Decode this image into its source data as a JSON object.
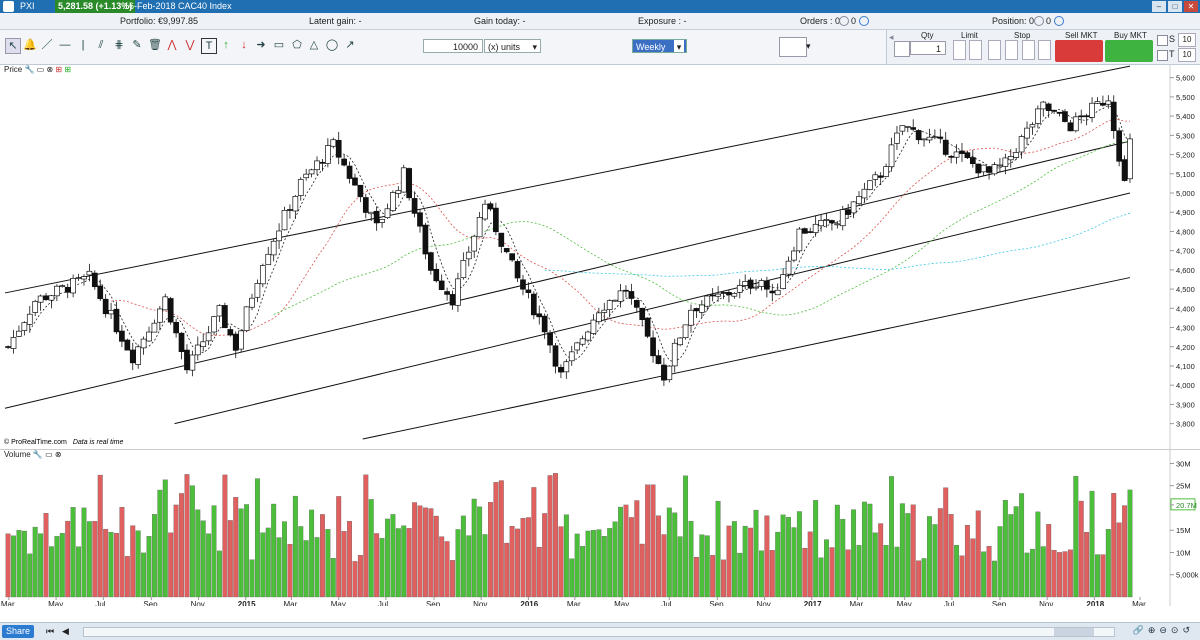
{
  "window": {
    "app": "PXI",
    "price_badge": "5,281.58 (+1.13%)",
    "instrument": "16-Feb-2018 CAC40 Index"
  },
  "infobar": {
    "portfolio_label": "Portfolio: €9,997.85",
    "latent_gain_label": "Latent gain: -",
    "gain_today_label": "Gain today: -",
    "exposure_label": "Exposure : -",
    "orders_label": "Orders : 0",
    "orders_b": "0",
    "position_label": "Position: 0",
    "position_b": "0"
  },
  "toolbar": {
    "quantity": "10000",
    "units": "(x) units",
    "period": "Weekly"
  },
  "order_panel": {
    "qty_label": "Qty",
    "qty_value": "1",
    "limit_label": "Limit",
    "stop_label": "Stop",
    "sell_label": "Sell MKT",
    "buy_label": "Buy MKT",
    "s_label": "S",
    "t_label": "T",
    "s_value": "10",
    "t_value": "10"
  },
  "price_panel": {
    "title": "Price",
    "attribution_a": "© ProRealTime.com",
    "attribution_b": "Data is real time"
  },
  "volume_panel": {
    "title": "Volume"
  },
  "footer": {
    "share_label": "Share"
  },
  "chart_data": {
    "type": "candlestick",
    "period": "weekly",
    "x_range": [
      "2014-02-24",
      "2018-02-16"
    ],
    "x_tick_labels": [
      "Mar",
      "May",
      "Jul",
      "Sep",
      "Nov",
      "2015",
      "Mar",
      "May",
      "Jul",
      "Sep",
      "Nov",
      "2016",
      "Mar",
      "May",
      "Jul",
      "Sep",
      "Nov",
      "2017",
      "Mar",
      "May",
      "Jul",
      "Sep",
      "Nov",
      "2018",
      "Mar"
    ],
    "y_tick_labels": [
      "5,600",
      "5,500",
      "5,400",
      "5,300",
      "5,200",
      "5,100",
      "5,000",
      "4,900",
      "4,800",
      "4,700",
      "4,600",
      "4,500",
      "4,400",
      "4,300",
      "4,200",
      "4,100",
      "4,000",
      "3,900",
      "3,800"
    ],
    "ylim": [
      3720,
      5640
    ],
    "last_close": 5281.58,
    "close_anchors": [
      {
        "date": "2014-02-28",
        "close": 4200
      },
      {
        "date": "2014-04-04",
        "close": 4440
      },
      {
        "date": "2014-06-13",
        "close": 4560
      },
      {
        "date": "2014-08-08",
        "close": 4150
      },
      {
        "date": "2014-09-19",
        "close": 4450
      },
      {
        "date": "2014-10-17",
        "close": 4080
      },
      {
        "date": "2014-11-28",
        "close": 4380
      },
      {
        "date": "2014-12-19",
        "close": 4200
      },
      {
        "date": "2015-01-23",
        "close": 4650
      },
      {
        "date": "2015-03-13",
        "close": 5050
      },
      {
        "date": "2015-04-24",
        "close": 5250
      },
      {
        "date": "2015-06-19",
        "close": 4820
      },
      {
        "date": "2015-07-24",
        "close": 5100
      },
      {
        "date": "2015-08-28",
        "close": 4600
      },
      {
        "date": "2015-09-25",
        "close": 4450
      },
      {
        "date": "2015-11-06",
        "close": 4950
      },
      {
        "date": "2015-12-18",
        "close": 4550
      },
      {
        "date": "2016-01-22",
        "close": 4300
      },
      {
        "date": "2016-02-12",
        "close": 4050
      },
      {
        "date": "2016-04-01",
        "close": 4400
      },
      {
        "date": "2016-05-06",
        "close": 4500
      },
      {
        "date": "2016-06-24",
        "close": 4050
      },
      {
        "date": "2016-07-29",
        "close": 4400
      },
      {
        "date": "2016-10-28",
        "close": 4550
      },
      {
        "date": "2016-11-11",
        "close": 4450
      },
      {
        "date": "2016-12-16",
        "close": 4800
      },
      {
        "date": "2017-02-03",
        "close": 4850
      },
      {
        "date": "2017-03-31",
        "close": 5100
      },
      {
        "date": "2017-04-28",
        "close": 5350
      },
      {
        "date": "2017-06-16",
        "close": 5250
      },
      {
        "date": "2017-08-18",
        "close": 5100
      },
      {
        "date": "2017-09-08",
        "close": 5150
      },
      {
        "date": "2017-10-27",
        "close": 5450
      },
      {
        "date": "2017-12-01",
        "close": 5350
      },
      {
        "date": "2018-01-19",
        "close": 5500
      },
      {
        "date": "2018-02-09",
        "close": 5050
      },
      {
        "date": "2018-02-16",
        "close": 5281.58
      }
    ],
    "channel_lines": [
      {
        "name": "upper",
        "from": {
          "date": "2014-02-24",
          "value": 4480
        },
        "to": {
          "date": "2018-02-16",
          "value": 5660
        }
      },
      {
        "name": "middle",
        "from": {
          "date": "2014-02-24",
          "value": 3880
        },
        "to": {
          "date": "2018-02-16",
          "value": 5270
        }
      },
      {
        "name": "lower",
        "from": {
          "date": "2015-06-01",
          "value": 3720
        },
        "to": {
          "date": "2018-02-16",
          "value": 4560
        }
      },
      {
        "name": "lower-mid",
        "from": {
          "date": "2014-10-01",
          "value": 3800
        },
        "to": {
          "date": "2018-02-16",
          "value": 5000
        }
      }
    ],
    "moving_averages": [
      {
        "period": 5,
        "color": "#222222",
        "style": "dashed"
      },
      {
        "period": 20,
        "color": "#d9534f",
        "style": "dashed"
      },
      {
        "period": 50,
        "color": "#4cbf3a",
        "style": "dashed"
      },
      {
        "period": 100,
        "color": "#3cc8e8",
        "style": "dashed"
      }
    ],
    "volume": {
      "y_tick_labels": [
        "30M",
        "25M",
        "20.7M",
        "15M",
        "10M",
        "5,000k"
      ],
      "ylim": [
        0,
        31000000
      ],
      "last_value_label": "20.7M",
      "up_color": "#4cbf3a",
      "down_color": "#e06060"
    }
  }
}
